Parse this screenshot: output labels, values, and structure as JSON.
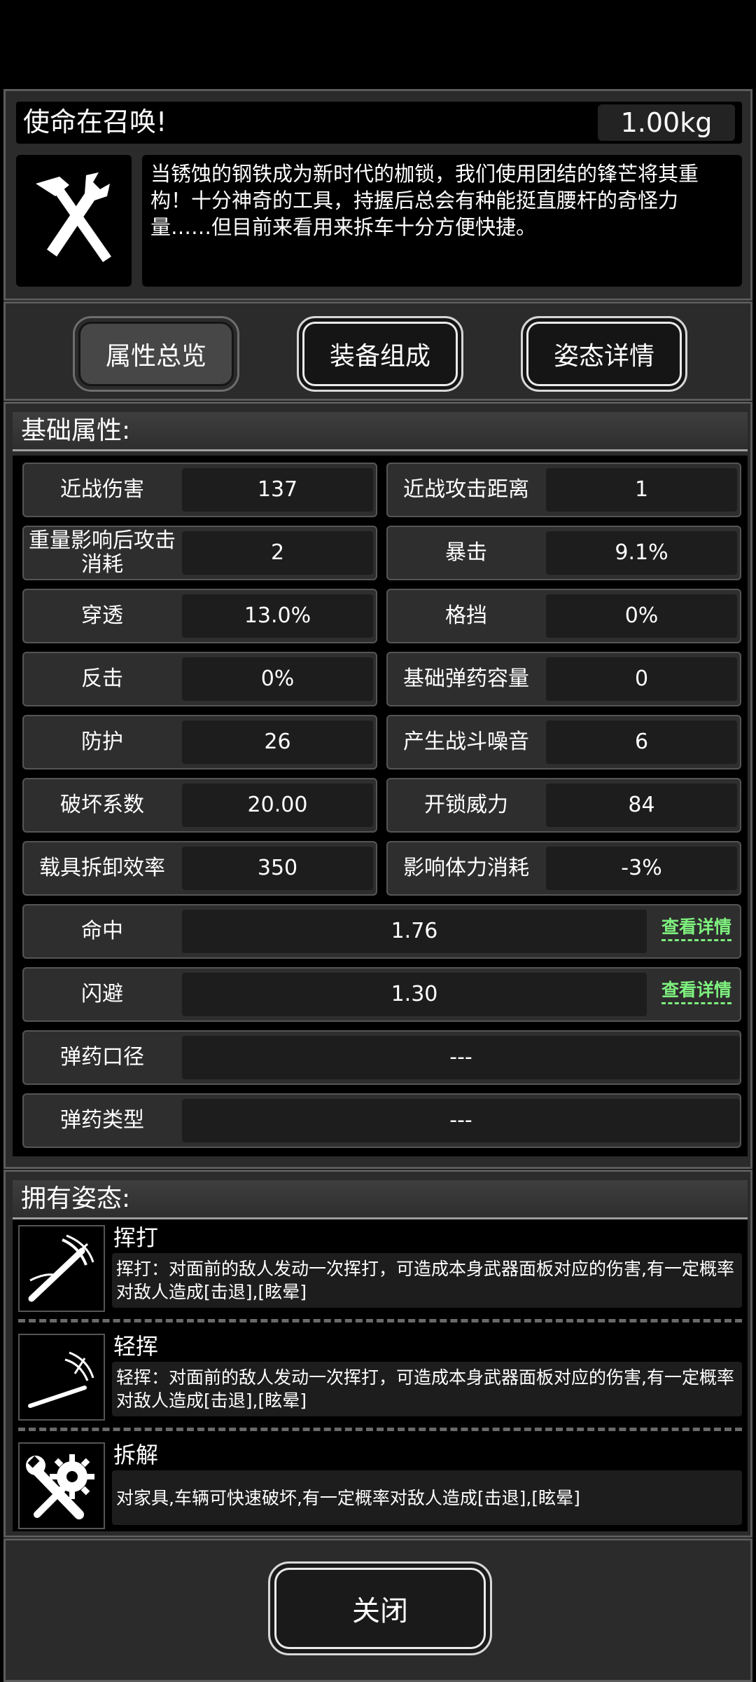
{
  "header": {
    "title": "使命在召唤!",
    "weight": "1.00kg",
    "description": "当锈蚀的钢铁成为新时代的枷锁，我们使用团结的锋芒将其重构！十分神奇的工具，持握后总会有种能挺直腰杆的奇怪力量……但目前来看用来拆车十分方便快捷。"
  },
  "tabs": [
    {
      "label": "属性总览",
      "active": true
    },
    {
      "label": "装备组成",
      "active": false
    },
    {
      "label": "姿态详情",
      "active": false
    }
  ],
  "stats": {
    "section_title": "基础属性:",
    "pairs": [
      {
        "left": {
          "label": "近战伤害",
          "value": "137"
        },
        "right": {
          "label": "近战攻击距离",
          "value": "1"
        }
      },
      {
        "left": {
          "label": "重量影响后攻击消耗",
          "value": "2"
        },
        "right": {
          "label": "暴击",
          "value": "9.1%"
        }
      },
      {
        "left": {
          "label": "穿透",
          "value": "13.0%"
        },
        "right": {
          "label": "格挡",
          "value": "0%"
        }
      },
      {
        "left": {
          "label": "反击",
          "value": "0%"
        },
        "right": {
          "label": "基础弹药容量",
          "value": "0"
        }
      },
      {
        "left": {
          "label": "防护",
          "value": "26"
        },
        "right": {
          "label": "产生战斗噪音",
          "value": "6"
        }
      },
      {
        "left": {
          "label": "破坏系数",
          "value": "20.00"
        },
        "right": {
          "label": "开锁威力",
          "value": "84"
        }
      },
      {
        "left": {
          "label": "载具拆卸效率",
          "value": "350"
        },
        "right": {
          "label": "影响体力消耗",
          "value": "-3%"
        }
      }
    ],
    "full_rows": [
      {
        "label": "命中",
        "value": "1.76",
        "link": "查看详情"
      },
      {
        "label": "闪避",
        "value": "1.30",
        "link": "查看详情"
      },
      {
        "label": "弹药口径",
        "value": "---"
      },
      {
        "label": "弹药类型",
        "value": "---"
      }
    ]
  },
  "stances": {
    "section_title": "拥有姿态:",
    "items": [
      {
        "icon": "swing-strike-icon",
        "name": "挥打",
        "desc": "挥打：对面前的敌人发动一次挥打，可造成本身武器面板对应的伤害,有一定概率对敌人造成[击退],[眩晕]"
      },
      {
        "icon": "light-swing-icon",
        "name": "轻挥",
        "desc": "轻挥：对面前的敌人发动一次挥打，可造成本身武器面板对应的伤害,有一定概率对敌人造成[击退],[眩晕]"
      },
      {
        "icon": "dismantle-icon",
        "name": "拆解",
        "desc": "对家具,车辆可快速破坏,有一定概率对敌人造成[击退],[眩晕]"
      }
    ]
  },
  "footer": {
    "close_label": "关闭"
  }
}
